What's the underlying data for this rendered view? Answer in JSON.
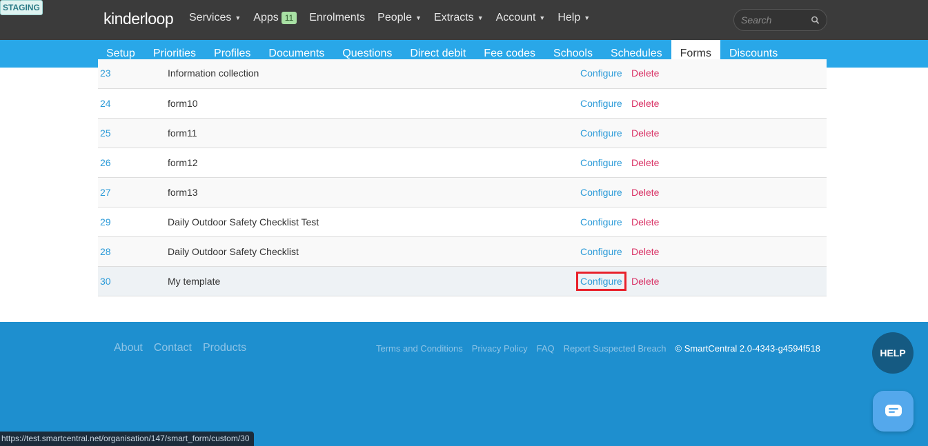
{
  "env_badge": "STAGING",
  "brand": "kinderloop",
  "topnav": [
    {
      "label": "Services",
      "caret": true
    },
    {
      "label": "Apps",
      "badge": "11"
    },
    {
      "label": "Enrolments"
    },
    {
      "label": "People",
      "caret": true
    },
    {
      "label": "Extracts",
      "caret": true
    },
    {
      "label": "Account",
      "caret": true
    },
    {
      "label": "Help",
      "caret": true
    }
  ],
  "search": {
    "placeholder": "Search"
  },
  "subtabs": [
    "Setup",
    "Priorities",
    "Profiles",
    "Documents",
    "Questions",
    "Direct debit",
    "Fee codes",
    "Schools",
    "Schedules",
    "Forms",
    "Discounts"
  ],
  "active_subtab": "Forms",
  "rows": [
    {
      "id": "23",
      "name": "Information collection",
      "configure": "Configure",
      "delete": "Delete"
    },
    {
      "id": "24",
      "name": "form10",
      "configure": "Configure",
      "delete": "Delete"
    },
    {
      "id": "25",
      "name": "form11",
      "configure": "Configure",
      "delete": "Delete"
    },
    {
      "id": "26",
      "name": "form12",
      "configure": "Configure",
      "delete": "Delete"
    },
    {
      "id": "27",
      "name": "form13",
      "configure": "Configure",
      "delete": "Delete"
    },
    {
      "id": "29",
      "name": "Daily Outdoor Safety Checklist Test",
      "configure": "Configure",
      "delete": "Delete"
    },
    {
      "id": "28",
      "name": "Daily Outdoor Safety Checklist",
      "configure": "Configure",
      "delete": "Delete"
    },
    {
      "id": "30",
      "name": "My template",
      "configure": "Configure",
      "delete": "Delete",
      "highlighted": true
    }
  ],
  "footer": {
    "left_links": [
      "About",
      "Contact",
      "Products"
    ],
    "right_links": [
      "Terms and Conditions",
      "Privacy Policy",
      "FAQ",
      "Report Suspected Breach"
    ],
    "copyright": "©  SmartCentral 2.0-4343-g4594f518"
  },
  "help_label": "HELP",
  "status_url": "https://test.smartcentral.net/organisation/147/smart_form/custom/30",
  "colors": {
    "topbar": "#3b3b3b",
    "subnav": "#29a7e8",
    "link": "#2a9ad8",
    "delete": "#d93366",
    "footer": "#1e8fcf",
    "highlight_box": "#e8202a"
  }
}
